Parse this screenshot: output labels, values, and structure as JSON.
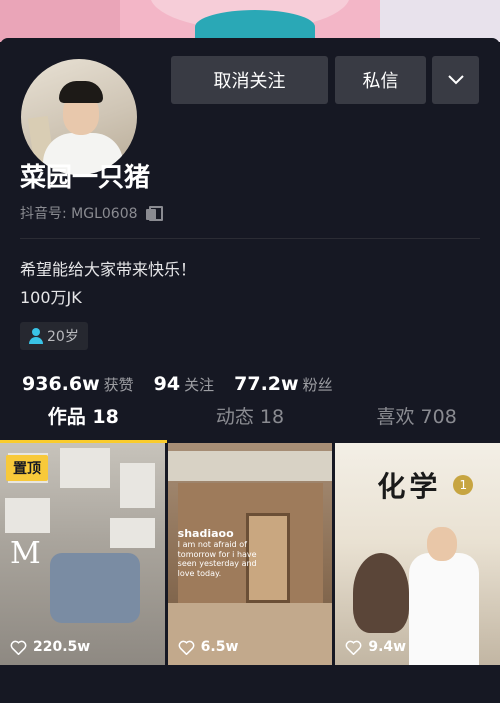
{
  "profile": {
    "name": "菜园一只猪",
    "douyin_id": "抖音号: MGL0608",
    "bio_line1": "希望能给大家带来快乐！",
    "bio_line2": "100万JK",
    "age_tag": "20岁"
  },
  "actions": {
    "unfollow_label": "取消关注",
    "message_label": "私信",
    "more_icon": "chevron-down-icon"
  },
  "stats": [
    {
      "value": "936.6w",
      "label": "获赞"
    },
    {
      "value": "94",
      "label": "关注"
    },
    {
      "value": "77.2w",
      "label": "粉丝"
    }
  ],
  "tabs": [
    {
      "label": "作品 18",
      "active": true
    },
    {
      "label": "动态 18",
      "active": false
    },
    {
      "label": "喜欢 708",
      "active": false
    }
  ],
  "videos": [
    {
      "pinned_label": "置顶",
      "likes": "220.5w",
      "overlay_text": "M"
    },
    {
      "likes": "6.5w",
      "overlay_title": "shadiaoo",
      "overlay_text": "I am not afraid of tomorrow for i have seen yesterday and love today."
    },
    {
      "likes": "9.4w",
      "book_title": "化学",
      "book_badge": "1"
    }
  ],
  "colors": {
    "background": "#161823",
    "button": "#393b44",
    "accent_tab": "#facc2d",
    "pinned_badge": "#f8c93a",
    "age_icon": "#39c3e6"
  }
}
